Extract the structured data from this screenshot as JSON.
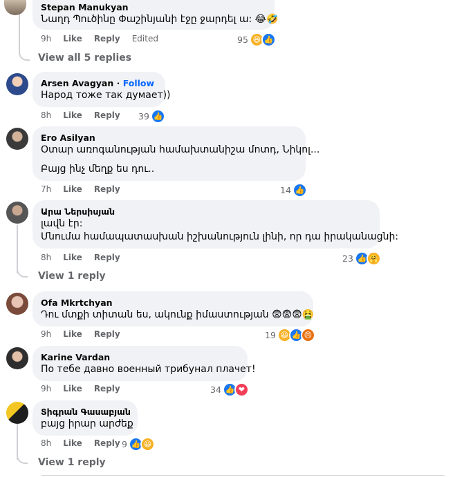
{
  "comments": [
    {
      "author": "Stepan Manukyan",
      "follow": "",
      "lines": [
        "Նաղդ Պուծինը Փաշինյանի էջը ջարդել ա: 😂🤣"
      ],
      "time": "9h",
      "like": "Like",
      "reply": "Reply",
      "edited": "Edited",
      "count": "95",
      "reactions": [
        "haha",
        "like"
      ]
    },
    {
      "author": "Arsen Avagyan",
      "follow": "Follow",
      "lines": [
        "Народ тоже так думает))"
      ],
      "time": "8h",
      "like": "Like",
      "reply": "Reply",
      "edited": "",
      "count": "39",
      "reactions": [
        "like"
      ]
    },
    {
      "author": "Ero Asilyan",
      "follow": "",
      "lines": [
        "Օտար առոգանության համախտանիշա մոտդ, Նիկոլ...",
        "Բայց ինչ մեղք ես դու.."
      ],
      "time": "7h",
      "like": "Like",
      "reply": "Reply",
      "edited": "",
      "count": "14",
      "reactions": [
        "like"
      ]
    },
    {
      "author": "Արա Ներսիսյան",
      "follow": "",
      "lines": [
        "լավն էր:",
        "Մնումա համապատասխան իշխանություն լինի, որ դա իրականացնի:"
      ],
      "time": "8h",
      "like": "Like",
      "reply": "Reply",
      "edited": "",
      "count": "23",
      "reactions": [
        "like",
        "care"
      ]
    },
    {
      "author": "Ofa Mkrtchyan",
      "follow": "",
      "lines": [
        "Դու մտքի տիտան ես, ակունք իմաստության 😨😨😨🤮"
      ],
      "time": "9h",
      "like": "Like",
      "reply": "Reply",
      "edited": "",
      "count": "19",
      "reactions": [
        "haha",
        "like",
        "angry"
      ]
    },
    {
      "author": "Karine Vardan",
      "follow": "",
      "lines": [
        "По тебе давно военный трибунал плачет!"
      ],
      "time": "9h",
      "like": "Like",
      "reply": "Reply",
      "edited": "",
      "count": "34",
      "reactions": [
        "like",
        "love"
      ]
    },
    {
      "author": "Տիգրան Գասաբյան",
      "follow": "",
      "lines": [
        "բայց իրար արժեք"
      ],
      "time": "8h",
      "like": "Like",
      "reply": "Reply",
      "edited": "",
      "count": "9",
      "reactions": [
        "like",
        "haha"
      ]
    }
  ],
  "view_replies": {
    "first": "View all 5 replies",
    "second": "View 1 reply",
    "third": "View 1 reply"
  },
  "reaction_icons": {
    "like": "thumbs-up-icon",
    "haha": "laughing-face-icon",
    "love": "heart-icon",
    "care": "hug-face-icon",
    "angry": "angry-face-icon"
  },
  "colors": {
    "bubble": "#f0f2f5",
    "meta": "#65676b",
    "like_blue": "#1877f2",
    "follow_blue": "#0866ff"
  }
}
